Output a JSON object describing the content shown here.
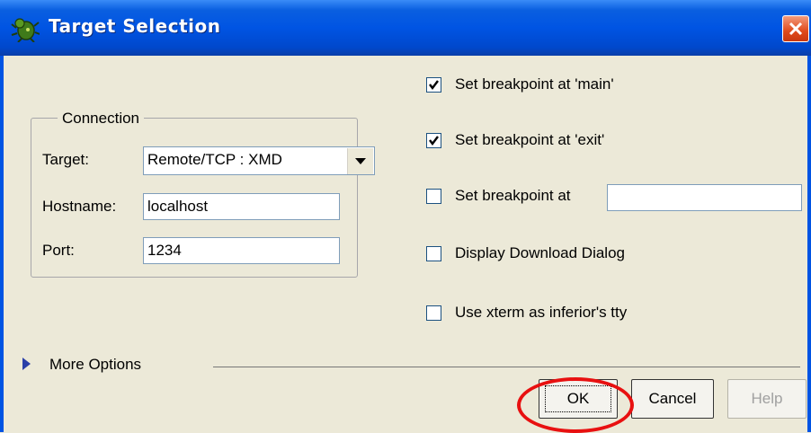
{
  "window": {
    "title": "Target Selection",
    "close_icon": "close-icon",
    "app_icon": "bug-icon"
  },
  "connection": {
    "group_label": "Connection",
    "target_label": "Target:",
    "target_value": "Remote/TCP : XMD",
    "hostname_label": "Hostname:",
    "hostname_value": "localhost",
    "port_label": "Port:",
    "port_value": "1234"
  },
  "options": [
    {
      "label": "Set breakpoint at 'main'",
      "checked": true
    },
    {
      "label": "Set breakpoint at 'exit'",
      "checked": true
    },
    {
      "label": "Set breakpoint at",
      "checked": false
    },
    {
      "label": "Display Download Dialog",
      "checked": false
    },
    {
      "label": "Use xterm as inferior's tty",
      "checked": false
    }
  ],
  "breakpoint_value": "",
  "more_options_label": "More Options",
  "buttons": {
    "ok": "OK",
    "cancel": "Cancel",
    "help": "Help"
  },
  "colors": {
    "titlebar": "#0054e3",
    "highlight_ring": "#e81010",
    "background": "#ece9d8"
  }
}
